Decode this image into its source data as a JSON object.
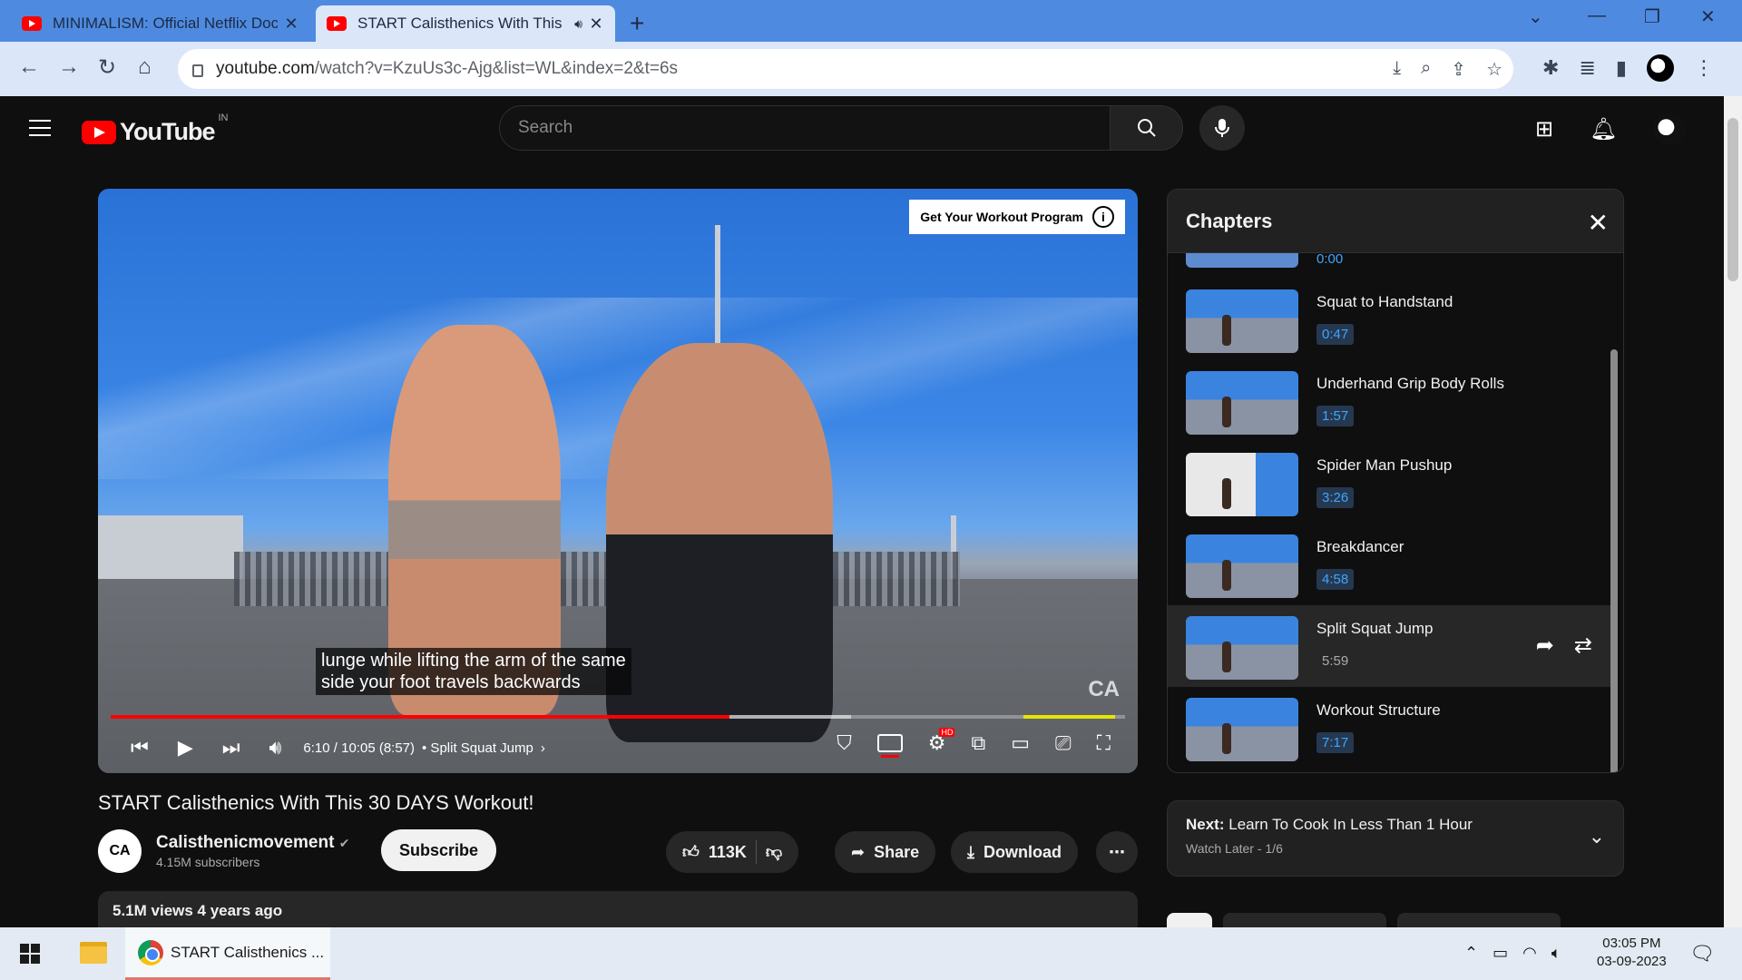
{
  "browser": {
    "tabs": [
      {
        "title": "MINIMALISM: Official Netflix Doc",
        "active": false
      },
      {
        "title": "START Calisthenics With This",
        "active": true,
        "audio_icon": "speaker-icon"
      }
    ],
    "url_host": "youtube.com",
    "url_path": "/watch?v=KzuUs3c-Ajg&list=WL&index=2&t=6s"
  },
  "youtube": {
    "logo_text": "YouTube",
    "country_code": "IN",
    "search_placeholder": "Search"
  },
  "player": {
    "cta_label": "Get Your Workout Program",
    "caption_line1": "lunge while lifting the arm of the same",
    "caption_line2": "side your foot travels backwards",
    "time_display": "6:10 / 10:05 (8:57)",
    "chapter_label": "• Split Squat Jump",
    "played_fraction": 0.61,
    "hd_badge": "HD"
  },
  "video": {
    "title": "START Calisthenics With This 30 DAYS Workout!",
    "channel_name": "Calisthenicmovement",
    "subscribers": "4.15M subscribers",
    "subscribe_label": "Subscribe",
    "likes": "113K",
    "share_label": "Share",
    "download_label": "Download",
    "views_line": "5.1M views  4 years ago"
  },
  "chapters": {
    "title": "Chapters",
    "partial_time": "0:00",
    "items": [
      {
        "name": "Squat to Handstand",
        "time": "0:47",
        "active": false
      },
      {
        "name": "Underhand Grip Body Rolls",
        "time": "1:57",
        "active": false
      },
      {
        "name": "Spider Man Pushup",
        "time": "3:26",
        "active": false
      },
      {
        "name": "Breakdancer",
        "time": "4:58",
        "active": false
      },
      {
        "name": "Split Squat Jump",
        "time": "5:59",
        "active": true
      },
      {
        "name": "Workout Structure",
        "time": "7:17",
        "active": false
      }
    ]
  },
  "next": {
    "prefix": "Next:",
    "title": "Learn To Cook In Less Than 1 Hour",
    "playlist": "Watch Later - 1/6"
  },
  "taskbar": {
    "app_label": "START Calisthenics ...",
    "time": "03:05 PM",
    "date": "03-09-2023"
  }
}
